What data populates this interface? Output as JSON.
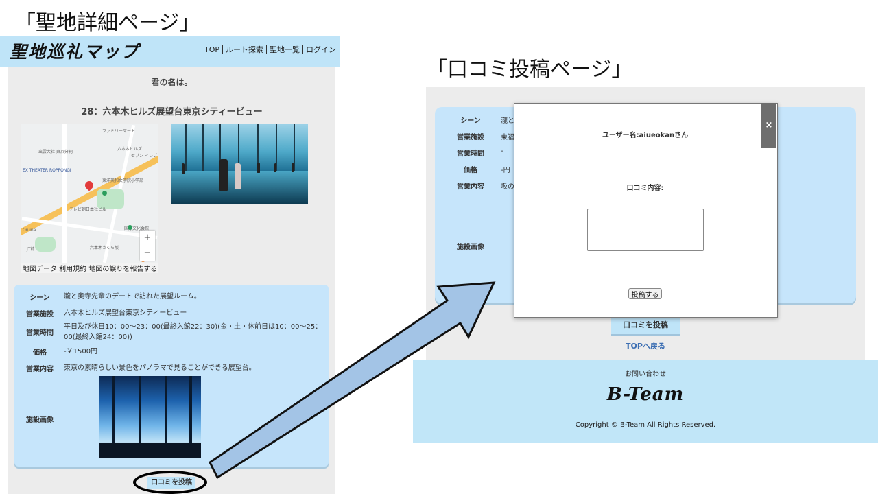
{
  "captions": {
    "detail": "「聖地詳細ページ」",
    "review": "「口コミ投稿ページ」"
  },
  "header": {
    "logo": "聖地巡礼マップ",
    "nav": [
      "TOP",
      "ルート探索",
      "聖地一覧",
      "ログイン"
    ]
  },
  "detail": {
    "anime_title": "君の名は。",
    "spot_title": "28：六本木ヒルズ展望台東京シティービュー",
    "map": {
      "labels": [
        "ファミリーマート",
        "六本木ヒルズ",
        "EX THEATER ROPPONGI",
        "セブン-イレブン",
        "テレビ朝日本社ビル",
        "出雲大社 東京分祠",
        "東洋英和女学院小学部",
        "国際文化会館",
        "六本木さくら坂",
        "Onlina",
        "JT前"
      ],
      "zoom_in": "+",
      "zoom_out": "−",
      "footer": "地図データ  利用規約  地図の誤りを報告する"
    },
    "info": {
      "scene_label": "シーン",
      "scene": "瀧と奥寺先輩のデートで訪れた展望ルーム。",
      "facility_label": "営業施設",
      "facility": "六本木ヒルズ展望台東京シティービュー",
      "hours_label": "営業時間",
      "hours": "平日及び休日10：00〜23：00(最終入館22：30)(金・土・休前日は10：00〜25：00(最終入館24：00))",
      "price_label": "価格",
      "price": "-￥1500円",
      "content_label": "営業内容",
      "content": "東京の素晴らしい景色をパノラマで見ることができる展望台。",
      "image_label": "施設画像"
    },
    "review_button": "口コミを投稿"
  },
  "review_page": {
    "rows": [
      {
        "k": "シーン",
        "v": "瀧と"
      },
      {
        "k": "営業施設",
        "v": "東福"
      },
      {
        "k": "営業時間",
        "v": "-"
      },
      {
        "k": "価格",
        "v": "-円"
      },
      {
        "k": "営業内容",
        "v": "坂の"
      }
    ],
    "image_label": "施設画像",
    "review_button": "口コミを投稿",
    "top_link": "TOPへ戻る",
    "modal": {
      "close": "×",
      "user": "ユーザー名:aiueokanさん",
      "content_label": "口コミ内容:",
      "textarea_value": "",
      "submit": "投稿する"
    },
    "footer": {
      "contact": "お問い合わせ",
      "brand": "B-Team",
      "copyright": "Copyright © B-Team All Rights Reserved."
    }
  },
  "colors": {
    "header_bg": "#bfe4f8",
    "card_bg": "#c6e5fb",
    "page_bg": "#ececec",
    "arrow_fill": "#a3c4e6",
    "link": "#3d6fb3"
  }
}
